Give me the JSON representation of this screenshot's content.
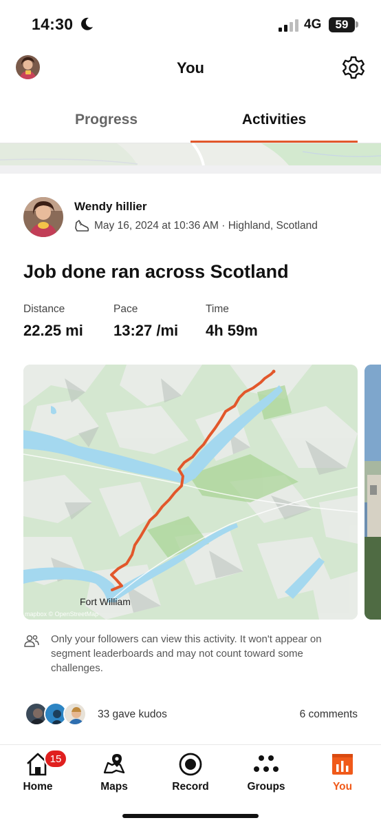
{
  "status_bar": {
    "time": "14:30",
    "network": "4G",
    "battery": "59"
  },
  "header": {
    "title": "You"
  },
  "tabs": [
    {
      "label": "Progress",
      "active": false
    },
    {
      "label": "Activities",
      "active": true
    }
  ],
  "activity": {
    "athlete_name": "Wendy hillier",
    "meta": "May 16, 2024 at 10:36 AM · Highland, Scotland",
    "title": "Job done ran across Scotland",
    "stats": [
      {
        "label": "Distance",
        "value": "22.25 mi"
      },
      {
        "label": "Pace",
        "value": "13:27 /mi"
      },
      {
        "label": "Time",
        "value": "4h 59m"
      }
    ],
    "map": {
      "place_label": "Fort William",
      "attribution": "mapbox © OpenStreetMap"
    },
    "privacy_note": "Only your followers can view this activity. It won't appear on segment leaderboards and may not count toward some challenges.",
    "kudos": "33 gave kudos",
    "comments": "6 comments"
  },
  "bottom_nav": {
    "items": [
      {
        "label": "Home",
        "icon": "home-icon",
        "badge": "15"
      },
      {
        "label": "Maps",
        "icon": "maps-icon"
      },
      {
        "label": "Record",
        "icon": "record-icon"
      },
      {
        "label": "Groups",
        "icon": "groups-icon"
      },
      {
        "label": "You",
        "icon": "you-icon",
        "active": true
      }
    ]
  },
  "colors": {
    "accent": "#f05a1a",
    "route": "#e2572b",
    "badge": "#e0201f",
    "water": "#9fd3ec",
    "land": "#cfe6c9"
  }
}
